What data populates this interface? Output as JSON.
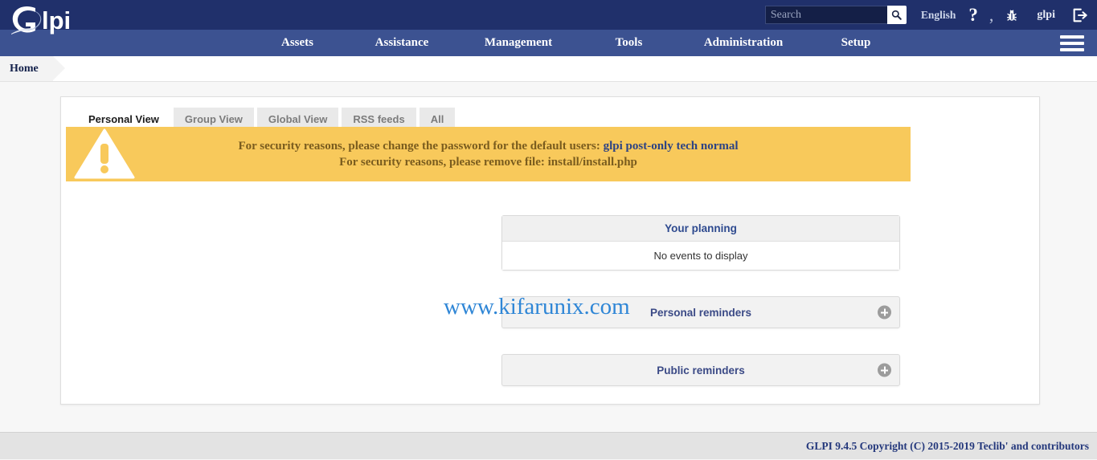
{
  "header": {
    "logo_text": "Glpi",
    "search": {
      "placeholder": "Search",
      "value": "",
      "button_icon": "search-icon"
    },
    "language": "English",
    "help_icon": "question-mark-icon",
    "notes_icon": "comma-icon",
    "bug_icon": "bug-icon",
    "username": "glpi",
    "logout_icon": "logout-icon"
  },
  "nav": {
    "items": [
      {
        "label": "Assets"
      },
      {
        "label": "Assistance"
      },
      {
        "label": "Management"
      },
      {
        "label": "Tools"
      },
      {
        "label": "Administration"
      },
      {
        "label": "Setup"
      }
    ],
    "menu_icon": "hamburger-menu-icon"
  },
  "breadcrumb": {
    "items": [
      {
        "label": "Home"
      }
    ]
  },
  "tabs": [
    {
      "label": "Personal View",
      "active": true
    },
    {
      "label": "Group View",
      "active": false
    },
    {
      "label": "Global View",
      "active": false
    },
    {
      "label": "RSS feeds",
      "active": false
    },
    {
      "label": "All",
      "active": false
    }
  ],
  "warning": {
    "icon": "warning-triangle-icon",
    "line1_prefix": "For security reasons, please change the password for the default users:",
    "line1_links": "glpi post-only tech normal",
    "line2": "For security reasons, please remove file: install/install.php",
    "bg_color": "#f8c95b",
    "text_color": "#7a5c1e",
    "link_color": "#2d4384"
  },
  "widgets": {
    "planning": {
      "title": "Your planning",
      "body": "No events to display"
    },
    "personal_reminders": {
      "title": "Personal reminders",
      "toggle_icon": "plus-circle-icon"
    },
    "public_reminders": {
      "title": "Public reminders",
      "toggle_icon": "plus-circle-icon"
    }
  },
  "watermark": {
    "text": "www.kifarunix.com",
    "color": "#2f86d6"
  },
  "footer": {
    "text": "GLPI 9.4.5 Copyright (C) 2015-2019 Teclib' and contributors",
    "color": "#24387c"
  }
}
